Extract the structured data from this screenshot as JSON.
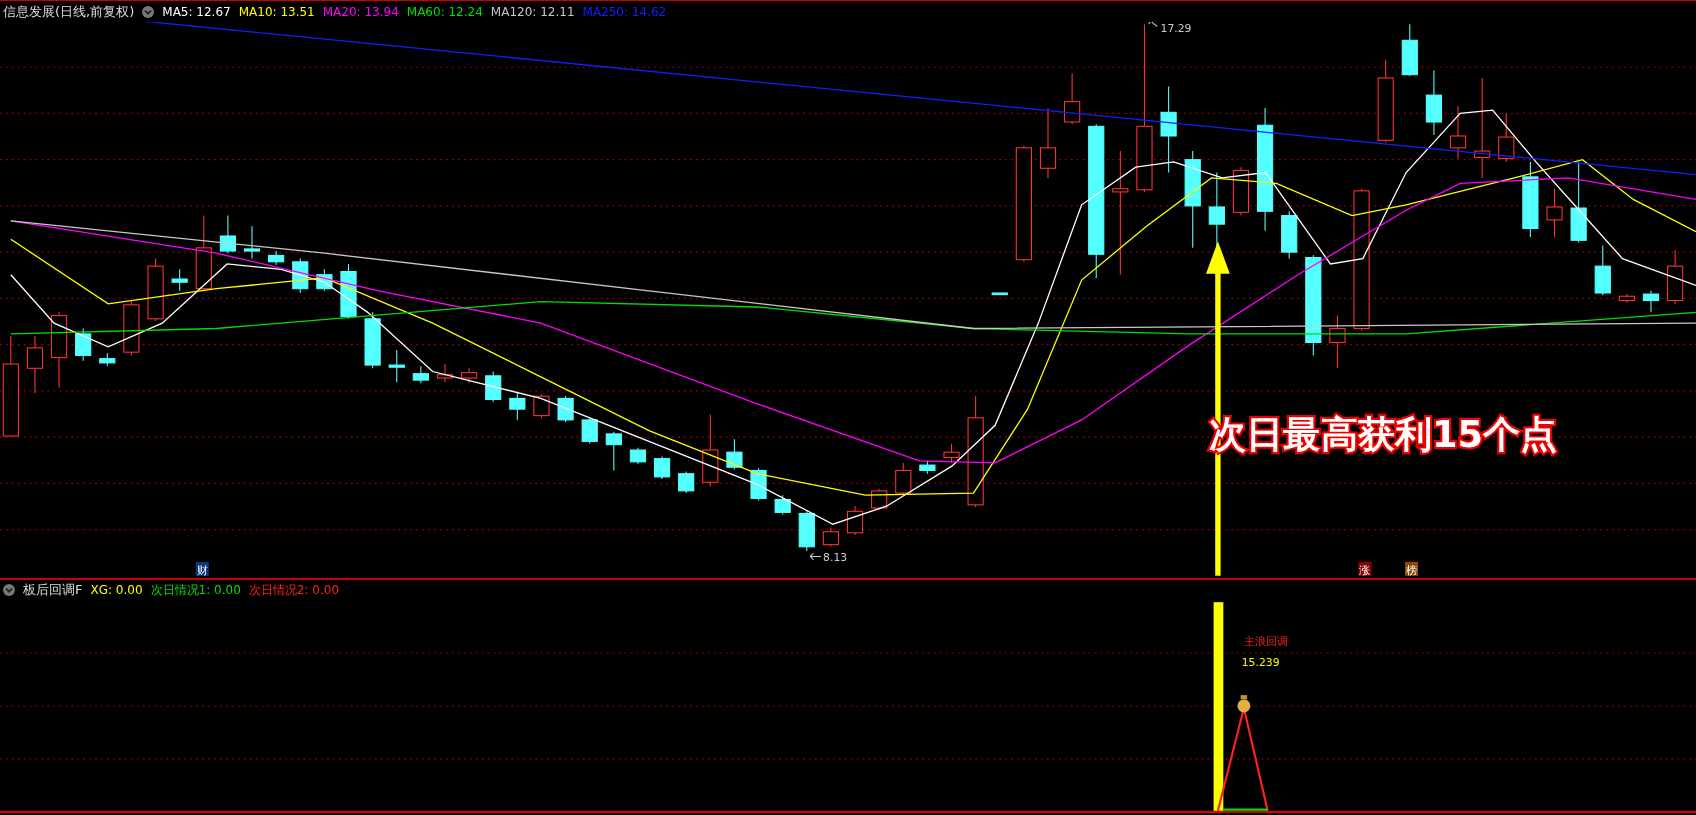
{
  "title_bar": {
    "title": "信息发展(日线,前复权)",
    "indicators": [
      {
        "label": "MA5: 12.67",
        "color": "#ffffff"
      },
      {
        "label": "MA10: 13.51",
        "color": "#ffff00"
      },
      {
        "label": "MA20: 13.94",
        "color": "#ff00ff"
      },
      {
        "label": "MA60: 12.24",
        "color": "#00e000"
      },
      {
        "label": "MA120: 12.11",
        "color": "#c8c8c8"
      },
      {
        "label": "MA250: 14.62",
        "color": "#1020ff"
      }
    ]
  },
  "price_chart": {
    "high_label": "17.29",
    "low_label": "8.13",
    "annotation": "次日最高获利15个点",
    "markers": [
      {
        "text": "财",
        "color": "#0a3a7a"
      },
      {
        "text": "涨",
        "color": "#8b0000"
      },
      {
        "text": "榜",
        "color": "#8b4a00"
      }
    ]
  },
  "sub_indicator": {
    "title": "板后回调F",
    "values": [
      {
        "label": "XG: 0.00",
        "color": "#ffff00"
      },
      {
        "label": "次日情况1: 0.00",
        "color": "#00e000"
      },
      {
        "label": "次日情况2: 0.00",
        "color": "#ff2020"
      }
    ],
    "signal_label": "主浪回调",
    "signal_value": "15.239"
  }
}
